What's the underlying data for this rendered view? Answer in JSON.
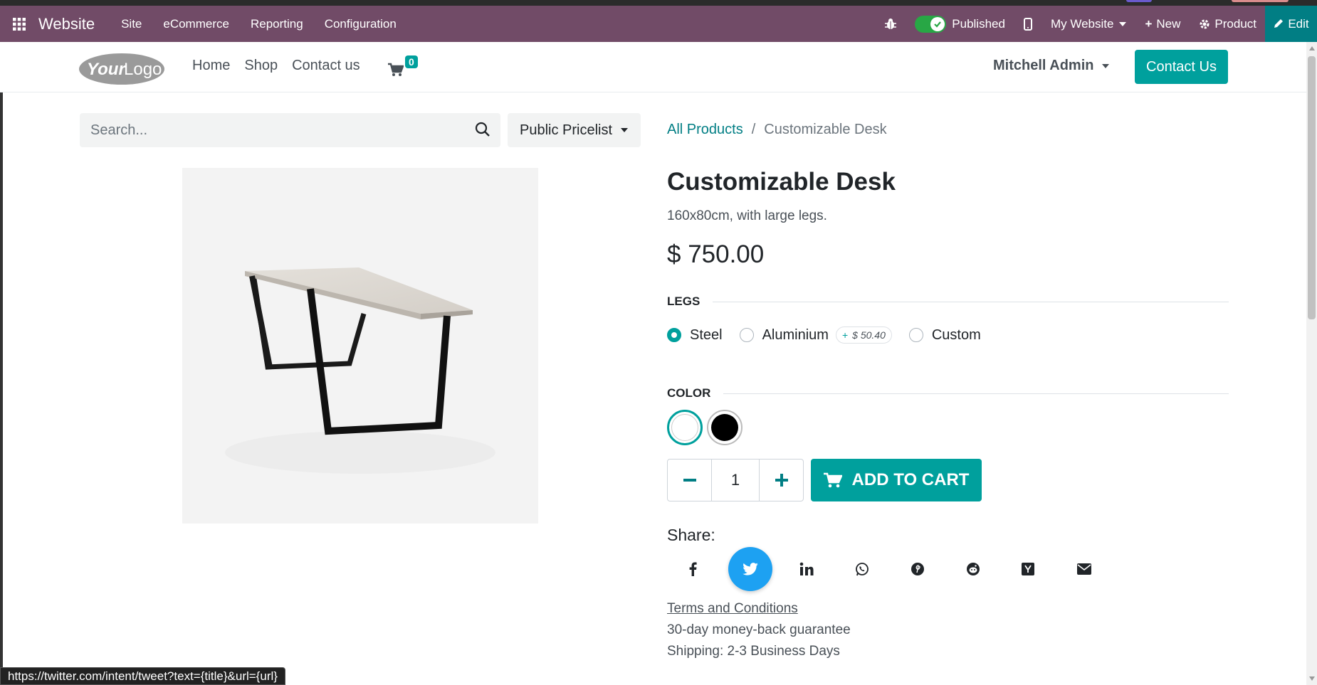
{
  "admin_bar": {
    "app_name": "Website",
    "menus": [
      "Site",
      "eCommerce",
      "Reporting",
      "Configuration"
    ],
    "published_label": "Published",
    "website_label": "My Website",
    "new_label": "New",
    "product_label": "Product",
    "edit_label": "Edit"
  },
  "header": {
    "nav": [
      "Home",
      "Shop",
      "Contact us"
    ],
    "cart_count": "0",
    "user_name": "Mitchell Admin",
    "contact_button": "Contact Us"
  },
  "search": {
    "placeholder": "Search...",
    "pricelist": "Public Pricelist"
  },
  "breadcrumb": {
    "root": "All Products",
    "current": "Customizable Desk"
  },
  "product": {
    "name": "Customizable Desk",
    "description": "160x80cm, with large legs.",
    "price": "$ 750.00",
    "legs_heading": "LEGS",
    "legs_options": [
      {
        "label": "Steel",
        "checked": true
      },
      {
        "label": "Aluminium",
        "extra": "$ 50.40"
      },
      {
        "label": "Custom"
      }
    ],
    "extra_plus": "+",
    "color_heading": "COLOR",
    "colors": [
      "#ffffff",
      "#000000"
    ],
    "quantity": "1",
    "add_to_cart": "ADD TO CART"
  },
  "share": {
    "label": "Share:",
    "icons": [
      "facebook-icon",
      "twitter-icon",
      "linkedin-icon",
      "whatsapp-icon",
      "pinterest-icon",
      "reddit-icon",
      "hackernews-icon",
      "email-icon"
    ]
  },
  "footer": {
    "terms": "Terms and Conditions",
    "guarantee": "30-day money-back guarantee",
    "shipping": "Shipping: 2-3 Business Days"
  },
  "status_url": "https://twitter.com/intent/tweet?text={title}&url={url}",
  "colors": {
    "admin_bar": "#714B67",
    "accent": "#00A09D",
    "edit": "#017e84"
  }
}
